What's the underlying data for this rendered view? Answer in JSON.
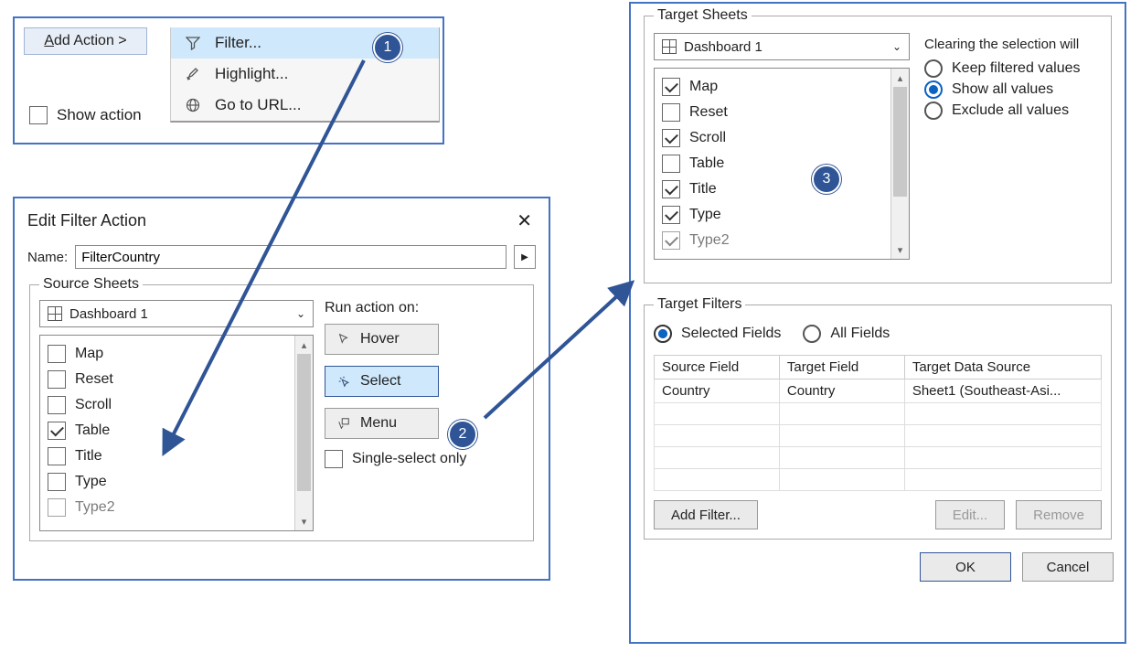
{
  "addAction": {
    "button": "Add Action >",
    "show_actions_label": "Show action",
    "menu": {
      "filter": "Filter...",
      "highlight": "Highlight...",
      "goto_url": "Go to URL..."
    }
  },
  "badges": {
    "b1": "1",
    "b2": "2",
    "b3": "3"
  },
  "editDialog": {
    "title": "Edit Filter Action",
    "name_label": "Name:",
    "name_value": "FilterCountry",
    "source_sheets_legend": "Source Sheets",
    "dashboard": "Dashboard 1",
    "sheets": {
      "s0": {
        "label": "Map",
        "checked": false
      },
      "s1": {
        "label": "Reset",
        "checked": false
      },
      "s2": {
        "label": "Scroll",
        "checked": false
      },
      "s3": {
        "label": "Table",
        "checked": true
      },
      "s4": {
        "label": "Title",
        "checked": false
      },
      "s5": {
        "label": "Type",
        "checked": false
      },
      "s6": {
        "label": "Type2",
        "checked": false
      }
    },
    "run_label": "Run action on:",
    "hover": "Hover",
    "select": "Select",
    "menu": "Menu",
    "single_select": "Single-select only"
  },
  "targets": {
    "sheets_legend": "Target Sheets",
    "dashboard": "Dashboard 1",
    "sheets": {
      "t0": {
        "label": "Map",
        "checked": true
      },
      "t1": {
        "label": "Reset",
        "checked": false
      },
      "t2": {
        "label": "Scroll",
        "checked": true
      },
      "t3": {
        "label": "Table",
        "checked": false
      },
      "t4": {
        "label": "Title",
        "checked": true
      },
      "t5": {
        "label": "Type",
        "checked": true
      },
      "t6": {
        "label": "Type2",
        "checked": true
      }
    },
    "clearing_label": "Clearing the selection will",
    "clearing_options": {
      "keep": "Keep filtered values",
      "show": "Show all values",
      "exclude": "Exclude all values"
    },
    "clearing_selected": "show",
    "filters_legend": "Target Filters",
    "filters_mode": {
      "selected": "Selected Fields",
      "all": "All Fields"
    },
    "columns": {
      "source": "Source Field",
      "target": "Target Field",
      "ds": "Target Data Source"
    },
    "row": {
      "source": "Country",
      "target": "Country",
      "ds": "Sheet1 (Southeast-Asi..."
    },
    "buttons": {
      "add": "Add Filter...",
      "edit": "Edit...",
      "remove": "Remove",
      "ok": "OK",
      "cancel": "Cancel"
    }
  }
}
